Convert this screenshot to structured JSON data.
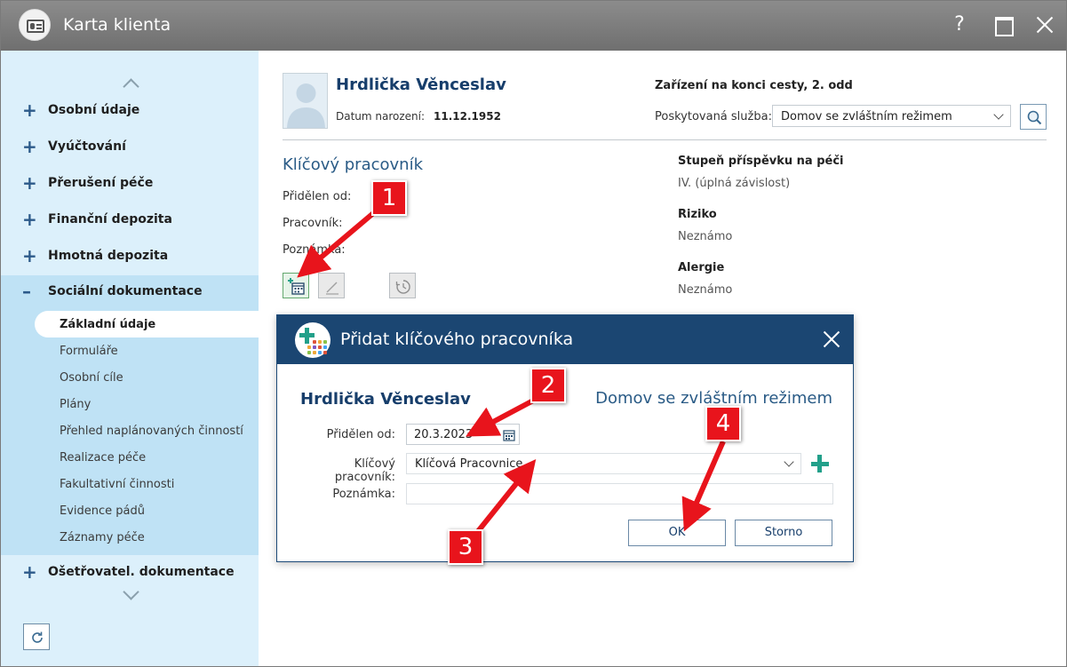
{
  "window": {
    "title": "Karta klienta",
    "help_label": "?"
  },
  "sidebar": {
    "items": [
      {
        "sign": "+",
        "label": "Osobní údaje"
      },
      {
        "sign": "+",
        "label": "Vyúčtování"
      },
      {
        "sign": "+",
        "label": "Přerušení péče"
      },
      {
        "sign": "+",
        "label": "Finanční depozita"
      },
      {
        "sign": "+",
        "label": "Hmotná depozita"
      },
      {
        "sign": "–",
        "label": "Sociální dokumentace"
      },
      {
        "sign": "+",
        "label": "Ošetřovatel. dokumentace"
      }
    ],
    "subitems": [
      "Základní údaje",
      "Formuláře",
      "Osobní cíle",
      "Plány",
      "Přehled naplánovaných činností",
      "Realizace péče",
      "Fakultativní činnosti",
      "Evidence pádů",
      "Záznamy péče"
    ]
  },
  "client": {
    "name": "Hrdlička Věnceslav",
    "dob_label": "Datum narození:",
    "dob": "11.12.1952",
    "facility": "Zařízení na konci cesty, 2. odd",
    "service_label": "Poskytovaná služba:",
    "service": "Domov se zvláštním režimem"
  },
  "key_worker": {
    "title": "Klíčový pracovník",
    "assigned_label": "Přidělen od:",
    "worker_label": "Pracovník:",
    "note_label": "Poznámka:"
  },
  "info": {
    "care_level_title": "Stupeň příspěvku na péči",
    "care_level": "IV. (úplná závislost)",
    "risk_title": "Riziko",
    "risk": "Neznámo",
    "allergy_title": "Alergie",
    "allergy": "Neznámo"
  },
  "dialog": {
    "title": "Přidat klíčového pracovníka",
    "client_name": "Hrdlička Věnceslav",
    "service": "Domov se zvláštním režimem",
    "assigned_label": "Přidělen od:",
    "assigned_value": "20.3.2023",
    "worker_label": "Klíčový pracovník:",
    "worker_value": "Klíčová Pracovnice",
    "note_label": "Poznámka:",
    "note_value": "",
    "ok_label": "OK",
    "cancel_label": "Storno"
  },
  "callouts": [
    "1",
    "2",
    "3",
    "4"
  ],
  "colors": {
    "accent": "#1b4672",
    "callout": "#e8141c",
    "add_green": "#22a08a",
    "sidebar_bg": "#dcf0fb"
  }
}
